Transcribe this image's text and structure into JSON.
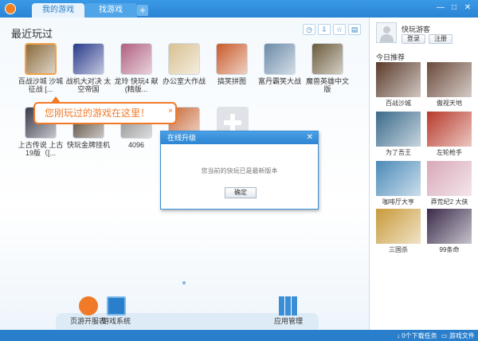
{
  "titlebar": {
    "tabs": [
      {
        "label": "我的游戏"
      },
      {
        "label": "找游戏"
      }
    ],
    "add_tab": "+",
    "window_controls": {
      "minimize": "—",
      "maximize": "□",
      "close": "✕"
    }
  },
  "main": {
    "section_title": "最近玩过",
    "games_row1": [
      {
        "label": "百战沙城 沙城征战 [...",
        "color": "#8a6a3a"
      },
      {
        "label": "战机大对决 太空帝国",
        "color": "#2a3a8a"
      },
      {
        "label": "龙玲 快玩4 献 (精版...",
        "color": "#b06080"
      },
      {
        "label": "办公室大作战",
        "color": "#d8c090"
      },
      {
        "label": "搞笑拼图",
        "color": "#c85a2a"
      },
      {
        "label": "富丹霸笑大战",
        "color": "#6a8aa8"
      },
      {
        "label": "魔兽英雄中文版",
        "color": "#6a5a3a"
      }
    ],
    "games_row2": [
      {
        "label": "上古传说 上古19版（[...",
        "color": "#3a3a4a"
      },
      {
        "label": "快玩金牌挂机",
        "color": "#4a3a2a"
      },
      {
        "label": "4096",
        "color": "#888888"
      },
      {
        "label": "",
        "color": "#c86a3a"
      }
    ],
    "tooltip": "您刚玩过的游戏在这里！",
    "tooltip_close": "×"
  },
  "dock": [
    {
      "label": "页游开服表",
      "icon": "page-game-icon"
    },
    {
      "label": "游戏系统",
      "icon": "monitor-icon"
    },
    {
      "label": "应用管理",
      "icon": "app-grid-icon"
    }
  ],
  "right_panel": {
    "username": "快玩游客",
    "login_label": "登录",
    "register_label": "注册",
    "rec_title": "今日推荐",
    "recommendations": [
      {
        "label": "百战沙城",
        "color": "#5a3a2a"
      },
      {
        "label": "傲视天地",
        "color": "#6a4a3a"
      },
      {
        "label": "为了吾王",
        "color": "#3a6a8a"
      },
      {
        "label": "左轮枪手",
        "color": "#b83a2a"
      },
      {
        "label": "咖啡厅大亨",
        "color": "#4a8ab8"
      },
      {
        "label": "莽荒纪2 大侠",
        "color": "#d8a8b8"
      },
      {
        "label": "三国杀",
        "color": "#c89a3a"
      },
      {
        "label": "99条命",
        "color": "#3a2a4a"
      }
    ]
  },
  "dialog": {
    "title": "在线升级",
    "message": "您当前的快玩已是最新版本",
    "ok_label": "确定",
    "close": "✕"
  },
  "statusbar": {
    "downloads": "0个下载任务",
    "game_folder": "游戏文件夹"
  },
  "colors": {
    "accent": "#2a84d4",
    "tooltip": "#f07a28"
  }
}
